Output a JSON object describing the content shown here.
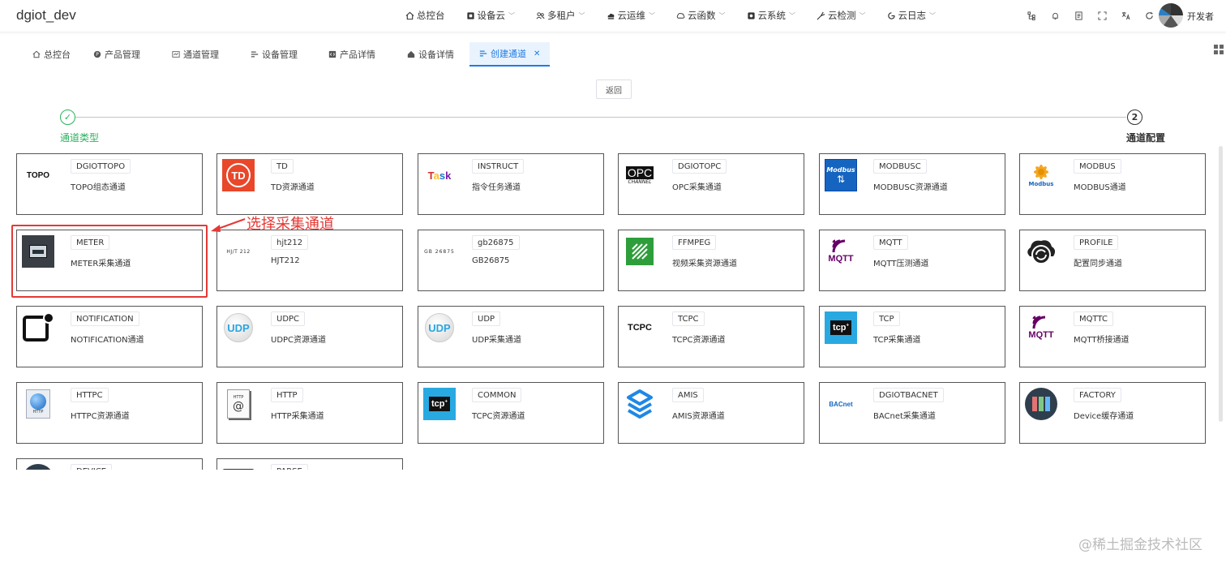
{
  "app": {
    "title": "dgiot_dev",
    "username": "开发者"
  },
  "topnav": [
    {
      "label": "总控台",
      "icon": "home-icon",
      "has_menu": false
    },
    {
      "label": "设备云",
      "icon": "device-cloud-icon",
      "has_menu": true
    },
    {
      "label": "多租户",
      "icon": "users-icon",
      "has_menu": true
    },
    {
      "label": "云运维",
      "icon": "cloud-ops-icon",
      "has_menu": true
    },
    {
      "label": "云函数",
      "icon": "cloud-function-icon",
      "has_menu": true
    },
    {
      "label": "云系统",
      "icon": "cloud-system-icon",
      "has_menu": true
    },
    {
      "label": "云检测",
      "icon": "cloud-detect-icon",
      "has_menu": true
    },
    {
      "label": "云日志",
      "icon": "cloud-log-icon",
      "has_menu": true
    }
  ],
  "tabs": [
    {
      "label": "总控台",
      "icon": "home-icon"
    },
    {
      "label": "产品管理",
      "icon": "product-icon"
    },
    {
      "label": "通道管理",
      "icon": "channel-icon"
    },
    {
      "label": "设备管理",
      "icon": "device-list-icon"
    },
    {
      "label": "产品详情",
      "icon": "code-icon"
    },
    {
      "label": "设备详情",
      "icon": "home-icon"
    },
    {
      "label": "创建通道",
      "icon": "list-icon",
      "active": true
    }
  ],
  "back_label": "返回",
  "steps": [
    {
      "label": "通道类型",
      "mark": "✓",
      "status": "done"
    },
    {
      "label": "通道配置",
      "mark": "2",
      "status": "pending"
    }
  ],
  "annotation": "选择采集通道",
  "watermark": "@稀土掘金技术社区",
  "cards": [
    {
      "tag": "DGIOTTOPO",
      "desc": "TOPO组态通道",
      "logo": "topo",
      "logo_text": "TOPO"
    },
    {
      "tag": "TD",
      "desc": "TD资源通道",
      "logo": "td",
      "logo_text": "TD"
    },
    {
      "tag": "INSTRUCT",
      "desc": "指令任务通道",
      "logo": "task",
      "logo_text": "Task"
    },
    {
      "tag": "DGIOTOPC",
      "desc": "OPC采集通道",
      "logo": "opc",
      "logo_text": "OPC",
      "logo_sub": "CHANNEL"
    },
    {
      "tag": "MODBUSC",
      "desc": "MODBUSC资源通道",
      "logo": "modbusc",
      "logo_text": "Modbus"
    },
    {
      "tag": "MODBUS",
      "desc": "MODBUS通道",
      "logo": "modbus",
      "logo_text": "Modbus"
    },
    {
      "tag": "METER",
      "desc": "METER采集通道",
      "logo": "meter"
    },
    {
      "tag": "hjt212",
      "desc": "HJT212",
      "logo": "hjt",
      "logo_text": "HJ/T 212"
    },
    {
      "tag": "gb26875",
      "desc": "GB26875",
      "logo": "gb",
      "logo_text": "GB 26875"
    },
    {
      "tag": "FFMPEG",
      "desc": "视频采集资源通道",
      "logo": "ffmpeg"
    },
    {
      "tag": "MQTT",
      "desc": "MQTT压测通道",
      "logo": "mqtt",
      "logo_text": "MQTT"
    },
    {
      "tag": "PROFILE",
      "desc": "配置同步通道",
      "logo": "profile"
    },
    {
      "tag": "NOTIFICATION",
      "desc": "NOTIFICATION通道",
      "logo": "notification"
    },
    {
      "tag": "UDPC",
      "desc": "UDPC资源通道",
      "logo": "udp",
      "logo_text": "UDP"
    },
    {
      "tag": "UDP",
      "desc": "UDP采集通道",
      "logo": "udp",
      "logo_text": "UDP"
    },
    {
      "tag": "TCPC",
      "desc": "TCPC资源通道",
      "logo": "tcpc-text",
      "logo_text": "TCPC"
    },
    {
      "tag": "TCP",
      "desc": "TCP采集通道",
      "logo": "tcp",
      "logo_text": "tcp"
    },
    {
      "tag": "MQTTC",
      "desc": "MQTT桥接通道",
      "logo": "mqtt",
      "logo_text": "MQTT"
    },
    {
      "tag": "HTTPC",
      "desc": "HTTPC资源通道",
      "logo": "httpc",
      "logo_text": "HTTP"
    },
    {
      "tag": "HTTP",
      "desc": "HTTP采集通道",
      "logo": "http",
      "logo_text": "HTTP"
    },
    {
      "tag": "COMMON",
      "desc": "TCPC资源通道",
      "logo": "tcp",
      "logo_text": "tcp"
    },
    {
      "tag": "AMIS",
      "desc": "AMIS资源通道",
      "logo": "amis"
    },
    {
      "tag": "DGIOTBACNET",
      "desc": "BACnet采集通道",
      "logo": "bacnet",
      "logo_text": "BACnet"
    },
    {
      "tag": "FACTORY",
      "desc": "Device缓存通道",
      "logo": "factory"
    },
    {
      "tag": "DEVICE",
      "desc": "",
      "logo": "device",
      "clipped": true
    },
    {
      "tag": "PARSE",
      "desc": "",
      "logo": "parse",
      "clipped": true
    }
  ]
}
